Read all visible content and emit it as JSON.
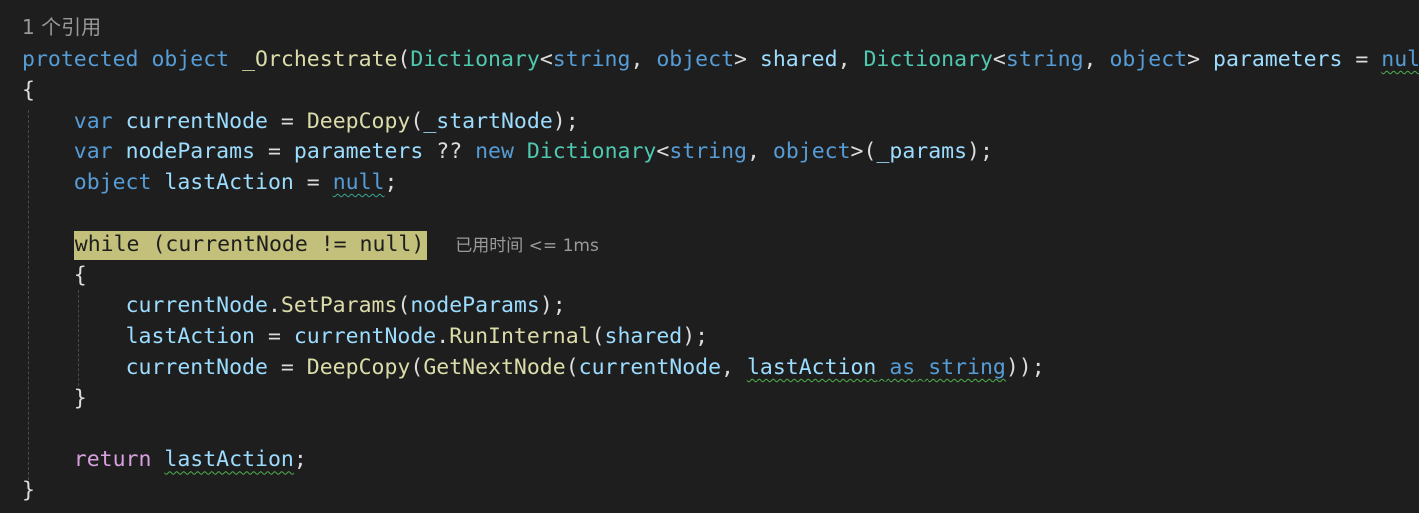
{
  "codelens": "1 个引用",
  "timing_hint": "已用时间 <= 1ms",
  "colors": {
    "background": "#1e1e1e",
    "keyword": "#569cd6",
    "control_keyword": "#d8a0df",
    "type": "#4ec9b0",
    "method": "#dcdcaa",
    "identifier": "#9cdcfe",
    "text": "#dcdcdc",
    "highlight": "#c2c07a",
    "squiggle": "#4eb04e"
  },
  "lines": [
    [
      {
        "t": "protected",
        "c": "kw"
      },
      {
        "t": " "
      },
      {
        "t": "object",
        "c": "kw"
      },
      {
        "t": " "
      },
      {
        "t": "_Orchestrate",
        "c": "method",
        "n": "method-name"
      },
      {
        "t": "("
      },
      {
        "t": "Dictionary",
        "c": "type"
      },
      {
        "t": "<"
      },
      {
        "t": "string",
        "c": "kw"
      },
      {
        "t": ", "
      },
      {
        "t": "object",
        "c": "kw"
      },
      {
        "t": "> "
      },
      {
        "t": "shared",
        "c": "id"
      },
      {
        "t": ", "
      },
      {
        "t": "Dictionary",
        "c": "type"
      },
      {
        "t": "<"
      },
      {
        "t": "string",
        "c": "kw"
      },
      {
        "t": ", "
      },
      {
        "t": "object",
        "c": "kw"
      },
      {
        "t": "> "
      },
      {
        "t": "parameters",
        "c": "id"
      },
      {
        "t": " = "
      },
      {
        "t": "null",
        "c": "kw",
        "sq": "green"
      },
      {
        "t": ")"
      }
    ],
    [
      {
        "t": "{"
      }
    ],
    [
      {
        "t": "    "
      },
      {
        "t": "var",
        "c": "kw"
      },
      {
        "t": " "
      },
      {
        "t": "currentNode",
        "c": "id"
      },
      {
        "t": " = "
      },
      {
        "t": "DeepCopy",
        "c": "method"
      },
      {
        "t": "("
      },
      {
        "t": "_startNode",
        "c": "id"
      },
      {
        "t": ");"
      }
    ],
    [
      {
        "t": "    "
      },
      {
        "t": "var",
        "c": "kw"
      },
      {
        "t": " "
      },
      {
        "t": "nodeParams",
        "c": "id"
      },
      {
        "t": " = "
      },
      {
        "t": "parameters",
        "c": "id"
      },
      {
        "t": " ?? "
      },
      {
        "t": "new",
        "c": "kw"
      },
      {
        "t": " "
      },
      {
        "t": "Dictionary",
        "c": "type"
      },
      {
        "t": "<"
      },
      {
        "t": "string",
        "c": "kw"
      },
      {
        "t": ", "
      },
      {
        "t": "object",
        "c": "kw"
      },
      {
        "t": ">("
      },
      {
        "t": "_params",
        "c": "id"
      },
      {
        "t": ");"
      }
    ],
    [
      {
        "t": "    "
      },
      {
        "t": "object",
        "c": "kw"
      },
      {
        "t": " "
      },
      {
        "t": "lastAction",
        "c": "id"
      },
      {
        "t": " = "
      },
      {
        "t": "null",
        "c": "kw",
        "sq": "teal"
      },
      {
        "t": ";"
      }
    ],
    [],
    [
      {
        "t": "    "
      },
      {
        "t": "while (currentNode != null)",
        "hl": true,
        "n": "current-statement-highlight"
      }
    ],
    [
      {
        "t": "    "
      },
      {
        "t": "{"
      }
    ],
    [
      {
        "t": "        "
      },
      {
        "t": "currentNode",
        "c": "id"
      },
      {
        "t": "."
      },
      {
        "t": "SetParams",
        "c": "method"
      },
      {
        "t": "("
      },
      {
        "t": "nodeParams",
        "c": "id"
      },
      {
        "t": ");"
      }
    ],
    [
      {
        "t": "        "
      },
      {
        "t": "lastAction",
        "c": "id"
      },
      {
        "t": " = "
      },
      {
        "t": "currentNode",
        "c": "id"
      },
      {
        "t": "."
      },
      {
        "t": "RunInternal",
        "c": "method"
      },
      {
        "t": "("
      },
      {
        "t": "shared",
        "c": "id"
      },
      {
        "t": ");"
      }
    ],
    [
      {
        "t": "        "
      },
      {
        "t": "currentNode",
        "c": "id"
      },
      {
        "t": " = "
      },
      {
        "t": "DeepCopy",
        "c": "method"
      },
      {
        "t": "("
      },
      {
        "t": "GetNextNode",
        "c": "method"
      },
      {
        "t": "("
      },
      {
        "t": "currentNode",
        "c": "id"
      },
      {
        "t": ", "
      },
      {
        "t": "lastAction",
        "c": "id",
        "sq": "green"
      },
      {
        "t": " ",
        "sq": "green"
      },
      {
        "t": "as",
        "c": "kw",
        "sq": "green"
      },
      {
        "t": " ",
        "sq": "green"
      },
      {
        "t": "string",
        "c": "kw",
        "sq": "green"
      },
      {
        "t": "));"
      }
    ],
    [
      {
        "t": "    "
      },
      {
        "t": "}"
      }
    ],
    [],
    [
      {
        "t": "    "
      },
      {
        "t": "return",
        "c": "ctl"
      },
      {
        "t": " "
      },
      {
        "t": "lastAction",
        "c": "id",
        "sq": "green"
      },
      {
        "t": ";"
      }
    ],
    [
      {
        "t": "}"
      }
    ]
  ]
}
